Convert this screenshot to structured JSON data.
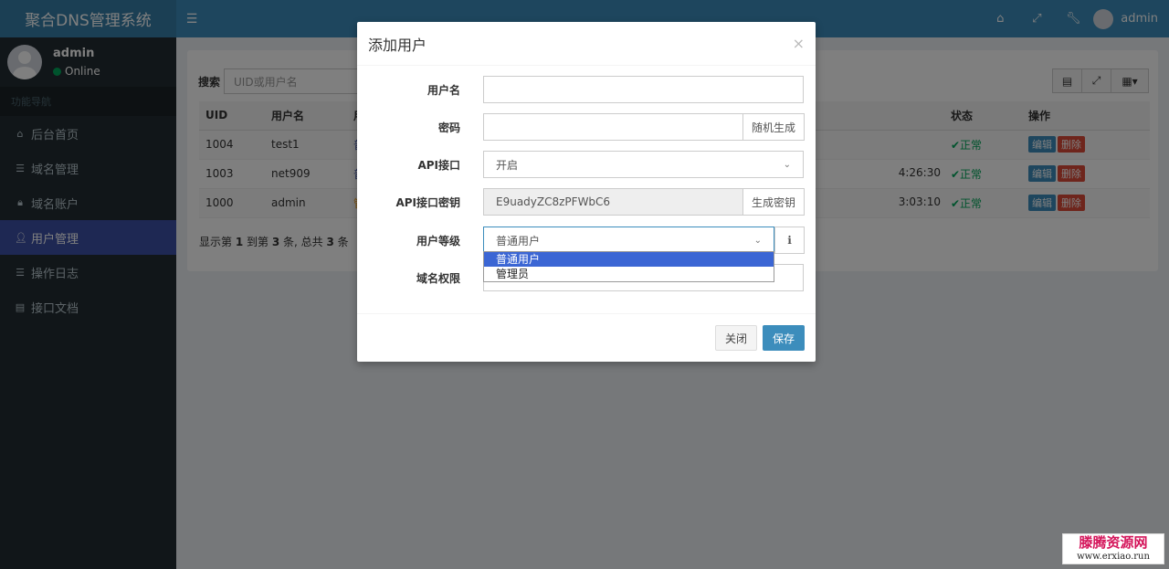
{
  "app": {
    "title": "聚合DNS管理系统"
  },
  "user_panel": {
    "name": "admin",
    "status": "Online"
  },
  "sidebar": {
    "header": "功能导航",
    "items": [
      {
        "label": "后台首页",
        "icon": "home-icon",
        "glyph": "⌂"
      },
      {
        "label": "域名管理",
        "icon": "list-icon",
        "glyph": "☰"
      },
      {
        "label": "域名账户",
        "icon": "lock-icon",
        "glyph": "🔒︎"
      },
      {
        "label": "用户管理",
        "icon": "user-icon",
        "glyph": "👤︎"
      },
      {
        "label": "操作日志",
        "icon": "list-icon",
        "glyph": "☰"
      },
      {
        "label": "接口文档",
        "icon": "book-icon",
        "glyph": "▤"
      }
    ]
  },
  "topbar": {
    "user": "admin"
  },
  "search": {
    "label": "搜索",
    "placeholder": "UID或用户名"
  },
  "table": {
    "headers": [
      "UID",
      "用户名",
      "用",
      "状态",
      "操作"
    ],
    "rows": [
      {
        "uid": "1004",
        "name": "test1",
        "col3": "普",
        "time": "",
        "status": "✔正常",
        "edit": "编辑",
        "del": "删除"
      },
      {
        "uid": "1003",
        "name": "net909",
        "col3": "普",
        "time": "4:26:30",
        "status": "✔正常",
        "edit": "编辑",
        "del": "删除"
      },
      {
        "uid": "1000",
        "name": "admin",
        "col3": "管",
        "time": "3:03:10",
        "status": "✔正常",
        "edit": "编辑",
        "del": "删除"
      }
    ]
  },
  "pager": {
    "prefix": "显示第 ",
    "from": "1",
    "mid1": " 到第 ",
    "to": "3",
    "mid2": " 条, 总共 ",
    "total": "3",
    "suffix": " 条"
  },
  "modal": {
    "title": "添加用户",
    "close_glyph": "×",
    "fields": {
      "username_label": "用户名",
      "username_value": "",
      "password_label": "密码",
      "password_value": "",
      "random_btn": "随机生成",
      "api_label": "API接口",
      "api_value": "开启",
      "apikey_label": "API接口密钥",
      "apikey_value": "E9uadyZC8zPFWbC6",
      "genkey_btn": "生成密钥",
      "level_label": "用户等级",
      "level_value": "普通用户",
      "level_options": [
        "普通用户",
        "管理员"
      ],
      "domain_label": "域名权限"
    },
    "close_btn": "关闭",
    "save_btn": "保存"
  },
  "watermark": {
    "line1": "滕腾资源网",
    "line2": "www.erxiao.run"
  },
  "colors": {
    "header": "#3c8dbc",
    "brand": "#367fa9",
    "sidebar": "#222d32",
    "active": "#3c50a6",
    "success": "#00a65a",
    "danger": "#dd4b39"
  }
}
